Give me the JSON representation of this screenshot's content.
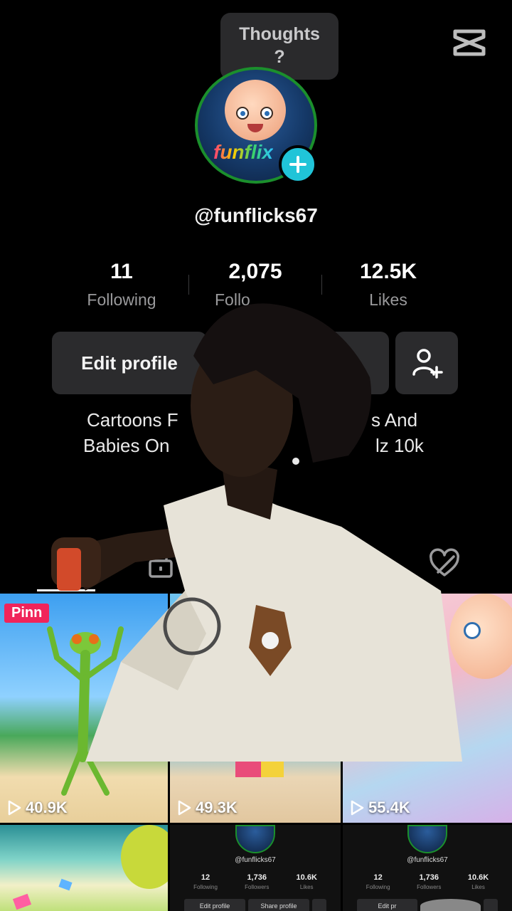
{
  "thoughts": {
    "line1": "Thoughts",
    "line2": "?"
  },
  "profile": {
    "username": "@funflicks67",
    "avatar_brand": "funflix",
    "stats": [
      {
        "value": "11",
        "label": "Following"
      },
      {
        "value": "2,075",
        "label": "Follo"
      },
      {
        "value": "12.5K",
        "label": "Likes"
      }
    ],
    "edit_profile_label": "Edit profile",
    "bio_line1_left": "Cartoons F",
    "bio_line1_right": "s And",
    "bio_line2_left": "Babies On",
    "bio_line2_right": "lz 10k"
  },
  "icons": {
    "capcut": "capcut-logo-icon",
    "add": "plus-icon",
    "add_friend": "add-friend-icon",
    "lock": "lock-icon",
    "liked": "liked-hidden-icon",
    "play": "play-icon"
  },
  "videos": [
    {
      "views": "40.9K",
      "pinned": "Pinn"
    },
    {
      "views": "49.3K"
    },
    {
      "views": "55.4K"
    }
  ],
  "mini_profile": {
    "username": "@funflicks67",
    "following": "12",
    "following_label": "Following",
    "followers": "1,736",
    "followers_label": "Followers",
    "likes": "10.6K",
    "likes_label": "Likes",
    "edit_label": "Edit profile",
    "share_label": "Share profile",
    "edit_label_short": "Edit pr"
  },
  "colors": {
    "accent_pink": "#f0245a",
    "plus_teal": "#20c4d8",
    "background": "#000000",
    "button_bg": "#2b2b2d"
  }
}
